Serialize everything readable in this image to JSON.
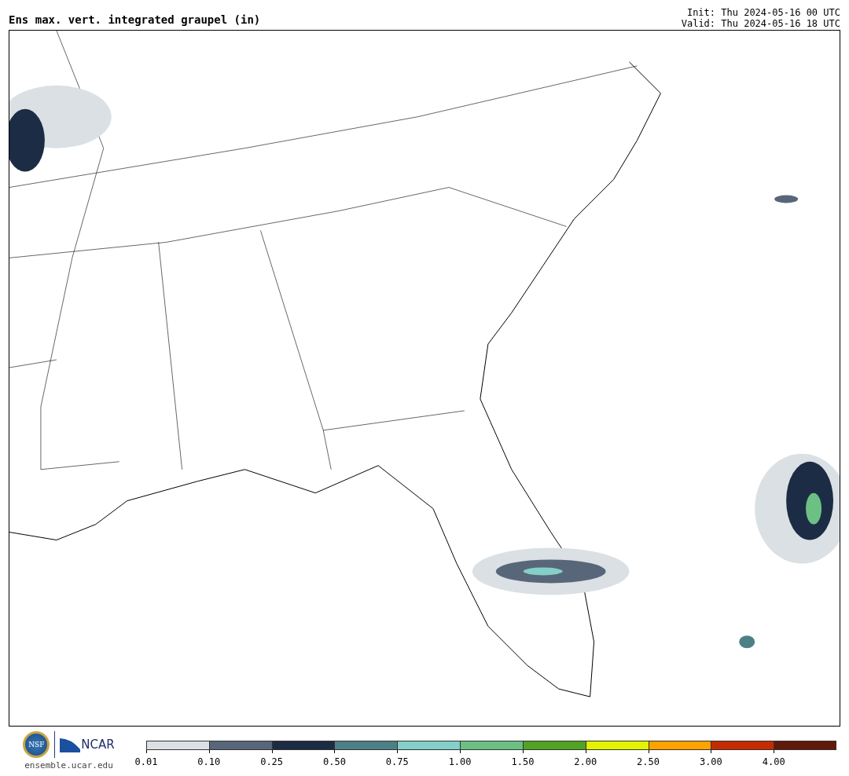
{
  "title": "Ens max. vert. integrated graupel (in)",
  "init": "Init: Thu 2024-05-16 00 UTC",
  "valid": "Valid: Thu 2024-05-16 18 UTC",
  "footer": {
    "nsf_logo": "NSF",
    "ncar_logo": "NCAR",
    "url": "ensemble.ucar.edu"
  },
  "colorbar": {
    "bins": [
      {
        "color": "#dbe0e4",
        "tick": "0.01"
      },
      {
        "color": "#58667a",
        "tick": "0.10"
      },
      {
        "color": "#1b2c44",
        "tick": "0.25"
      },
      {
        "color": "#4d8086",
        "tick": "0.50"
      },
      {
        "color": "#84cfc8",
        "tick": "0.75"
      },
      {
        "color": "#6cc084",
        "tick": "1.00"
      },
      {
        "color": "#52a324",
        "tick": "1.50"
      },
      {
        "color": "#e2f200",
        "tick": "2.00"
      },
      {
        "color": "#fea200",
        "tick": "2.50"
      },
      {
        "color": "#c42b00",
        "tick": "3.00"
      },
      {
        "color": "#62180b",
        "tick": "4.00"
      }
    ]
  }
}
